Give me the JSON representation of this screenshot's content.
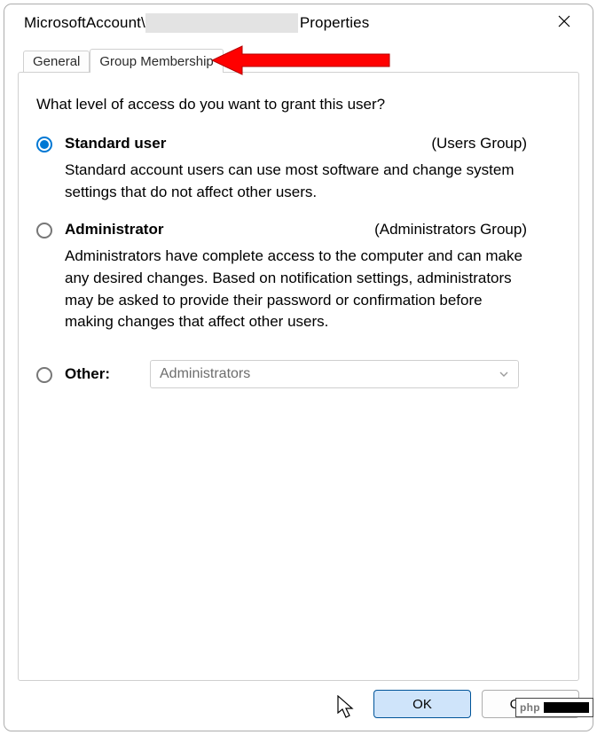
{
  "title": {
    "prefix": "MicrosoftAccount\\",
    "suffix": "Properties"
  },
  "tabs": {
    "general": "General",
    "group": "Group Membership",
    "active": "group"
  },
  "prompt": "What level of access do you want to grant this user?",
  "options": {
    "standard": {
      "name": "Standard user",
      "group": "(Users Group)",
      "desc": "Standard account users can use most software and change system settings that do not affect other users.",
      "selected": true
    },
    "admin": {
      "name": "Administrator",
      "group": "(Administrators Group)",
      "desc": "Administrators have complete access to the computer and can make any desired changes. Based on notification settings, administrators may be asked to provide their password or confirmation before making changes that affect other users.",
      "selected": false
    },
    "other": {
      "name": "Other:",
      "combo_value": "Administrators",
      "selected": false
    }
  },
  "buttons": {
    "ok": "OK",
    "cancel": "Cancel"
  },
  "watermark": "php"
}
